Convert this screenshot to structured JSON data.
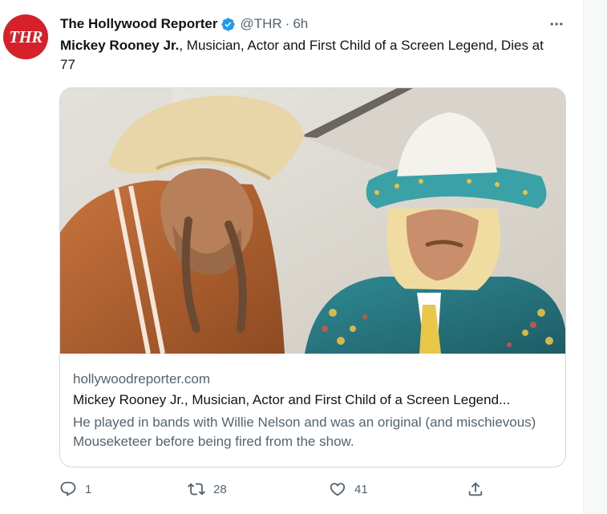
{
  "tweet": {
    "author": {
      "display_name": "The Hollywood Reporter",
      "handle": "@THR",
      "separator": "·",
      "time": "6h",
      "avatar_text": "THR",
      "verified_icon": "verified-badge-icon"
    },
    "text_bold": "Mickey Rooney Jr.",
    "text_rest": ", Musician, Actor and First Child of a Screen Legend, Dies at 77",
    "more_icon": "more-icon",
    "card": {
      "image_alt": "Willie Nelson and Mickey Rooney Jr. in cowboy hats",
      "domain": "hollywoodreporter.com",
      "title": "Mickey Rooney Jr., Musician, Actor and First Child of a Screen Legend...",
      "description": "He played in bands with Willie Nelson and was an original (and mischievous) Mouseketeer before being fired from the show."
    },
    "actions": {
      "reply_count": "1",
      "retweet_count": "28",
      "like_count": "41",
      "reply_icon": "reply-icon",
      "retweet_icon": "retweet-icon",
      "like_icon": "heart-icon",
      "share_icon": "share-icon"
    }
  },
  "colors": {
    "avatar_bg": "#d6202a",
    "verified": "#1d9bf0",
    "secondary_text": "#536471",
    "primary_text": "#0f1419",
    "border": "#cfd9de"
  }
}
